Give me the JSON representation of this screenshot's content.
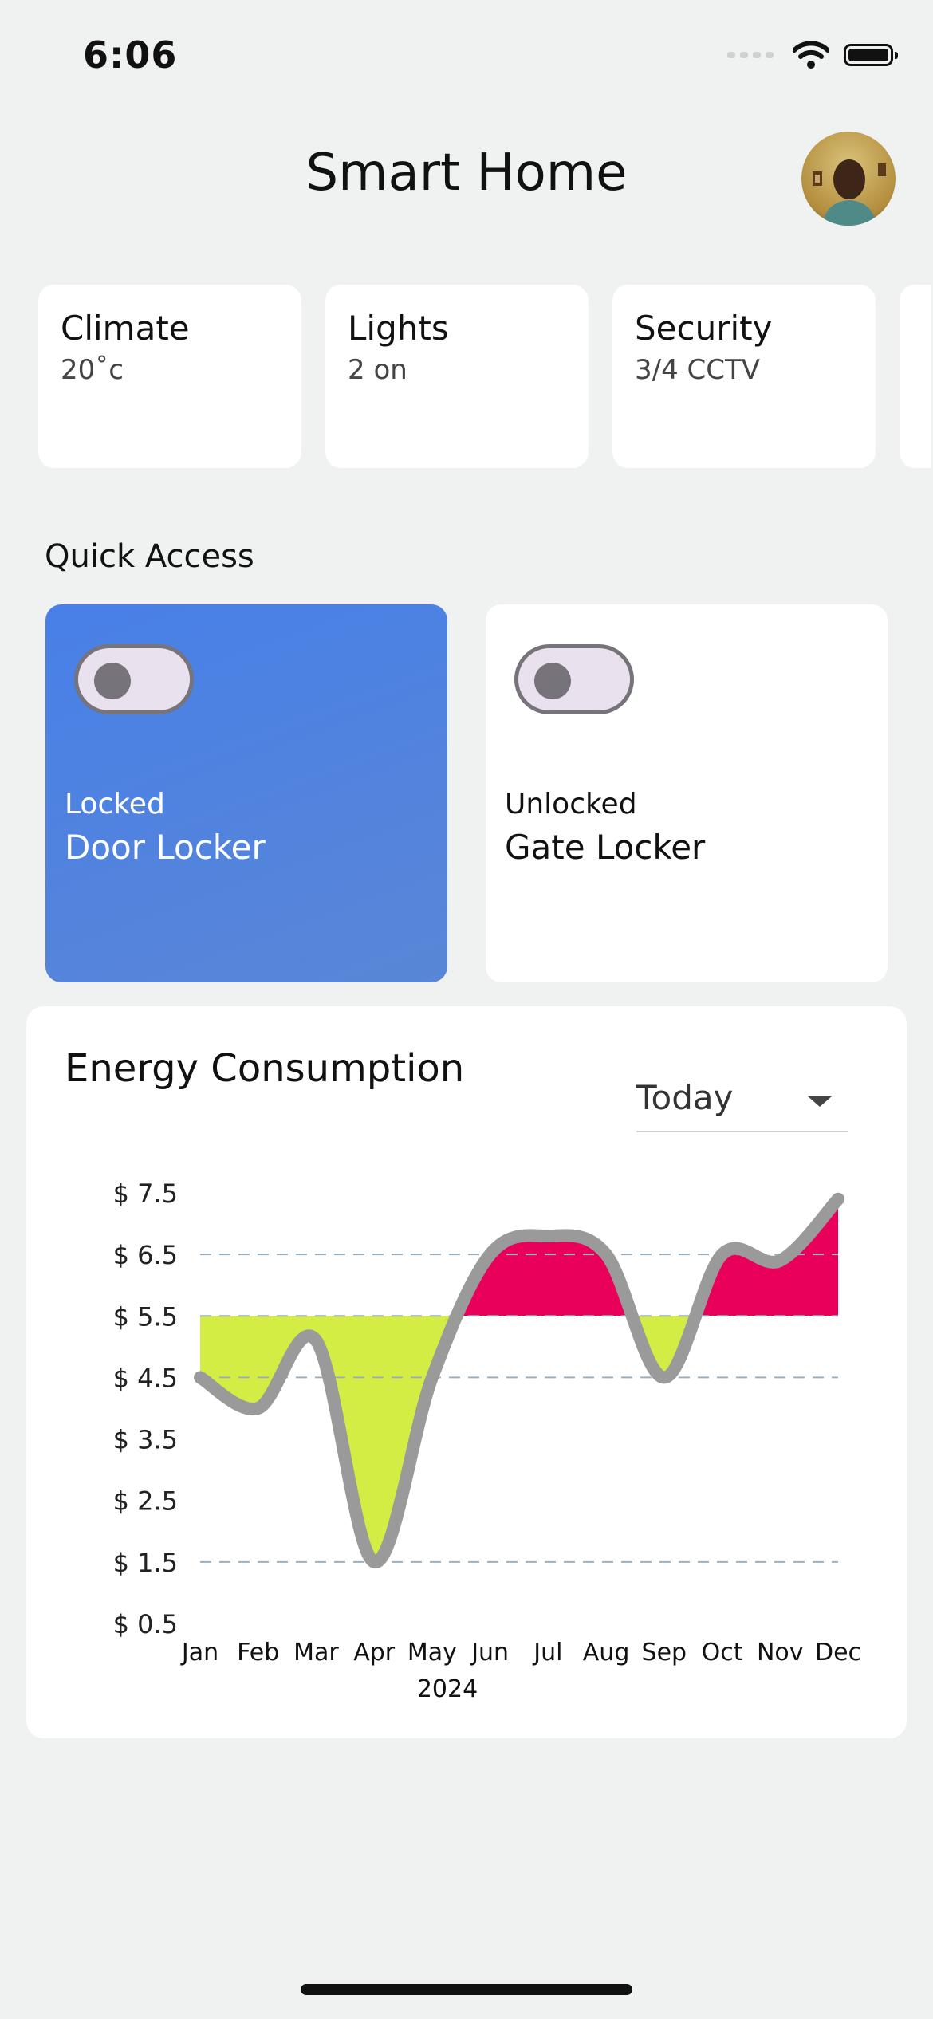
{
  "status_bar": {
    "time": "6:06"
  },
  "header": {
    "title": "Smart Home",
    "avatar_icon": "user-avatar"
  },
  "categories": [
    {
      "name": "Climate",
      "value": "20˚c"
    },
    {
      "name": "Lights",
      "value": "2 on"
    },
    {
      "name": "Security",
      "value": "3/4 CCTV"
    }
  ],
  "quick_access": {
    "label": "Quick Access",
    "tiles": [
      {
        "state": "Locked",
        "label": "Door Locker",
        "accent": "#4a7fe6"
      },
      {
        "state": "Unlocked",
        "label": "Gate Locker"
      }
    ]
  },
  "energy": {
    "title": "Energy Consumption",
    "period": "Today"
  },
  "chart_data": {
    "type": "area",
    "title": "",
    "xlabel": "2024",
    "ylabel": "",
    "categories": [
      "Jan",
      "Feb",
      "Mar",
      "Apr",
      "May",
      "Jun",
      "Jul",
      "Aug",
      "Sep",
      "Oct",
      "Nov",
      "Dec"
    ],
    "yticks": [
      "$ 7.5",
      "$ 6.5",
      "$ 5.5",
      "$ 4.5",
      "$ 3.5",
      "$ 2.5",
      "$ 1.5",
      "$ 0.5"
    ],
    "ylim": [
      0.5,
      7.5
    ],
    "baseline": 5.5,
    "gridlines": [
      6.5,
      5.5,
      4.5,
      1.5
    ],
    "series": [
      {
        "values": [
          4.5,
          4.0,
          5.1,
          1.5,
          4.5,
          6.5,
          6.8,
          6.5,
          4.5,
          6.5,
          6.4,
          7.4
        ]
      }
    ],
    "colors": {
      "line": "#9a9a9a",
      "above": "#e8005a",
      "below": "#d3ed45",
      "grid": "#9ab0c0"
    }
  }
}
